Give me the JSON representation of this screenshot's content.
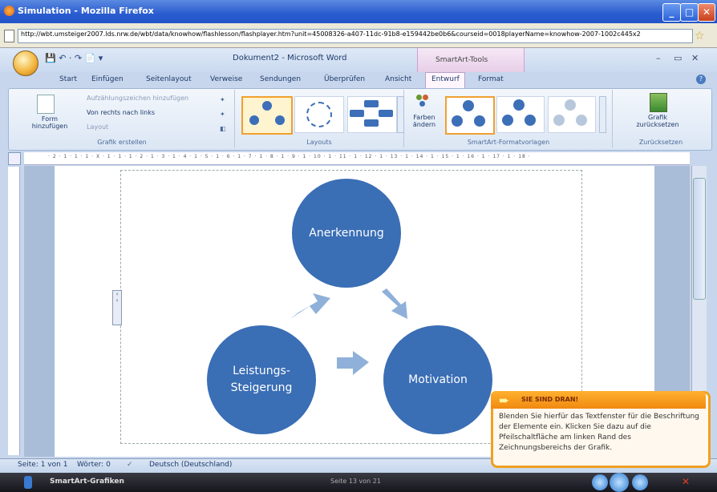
{
  "firefox": {
    "title": "Simulation - Mozilla Firefox",
    "url": "http://wbt.umsteiger2007.lds.nrw.de/wbt/data/knowhow/flashlesson/flashplayer.htm?unit=45008326-a407-11dc-91b8-e159442be0b6&courseid=0018playerName=knowhow-2007-1002c445x2"
  },
  "word": {
    "doc_title": "Dokument2 - Microsoft Word",
    "context_tab": "SmartArt-Tools",
    "tabs": [
      "Start",
      "Einfügen",
      "Seitenlayout",
      "Verweise",
      "Sendungen",
      "Überprüfen",
      "Ansicht",
      "Entwurf",
      "Format"
    ],
    "active_tab": "Entwurf"
  },
  "ribbon": {
    "group1": {
      "form_label": "Form hinzufügen",
      "bullet_label": "Aufzählungszeichen hinzufügen",
      "rtl_label": "Von rechts nach links",
      "layout_label": "Layout",
      "name": "Grafik erstellen"
    },
    "group2": {
      "name": "Layouts"
    },
    "group3": {
      "colors_label": "Farben ändern",
      "name": "SmartArt-Formatvorlagen"
    },
    "group4": {
      "reset_label": "Grafik zurücksetzen",
      "name": "Zurücksetzen"
    }
  },
  "ruler": {
    "text": "· 2 · 1 · 1 · 1 · X · 1 · 1 · 1 · 2 · 1 · 3 · 1 · 4 · 1 · 5 · 1 · 6 · 1 · 7 · 1 · 8 · 1 · 9 · 1 · 10 · 1 · 11 · 1 · 12 · 1 · 13 · 1 · 14 · 1 · 15 · 1 · 16 · 1 · 17 · 1 · 18 ·"
  },
  "diagram": {
    "top": "Anerkennung",
    "right": "Motivation",
    "left_line1": "Leistungs-",
    "left_line2": "Steigerung",
    "color": "#3a6eb5"
  },
  "status": {
    "page": "Seite: 1 von 1",
    "words": "Wörter: 0",
    "language": "Deutsch (Deutschland)"
  },
  "bottom": {
    "label": "SmartArt-Grafiken",
    "page": "Seite 13 von 21"
  },
  "tip": {
    "title": "SIE SIND DRAN!",
    "text": "Blenden Sie hierfür das Textfenster für die Beschriftung der Elemente ein. Klicken Sie dazu auf die Pfeilschaltfläche am linken Rand des Zeichnungsbereichs der Grafik."
  }
}
